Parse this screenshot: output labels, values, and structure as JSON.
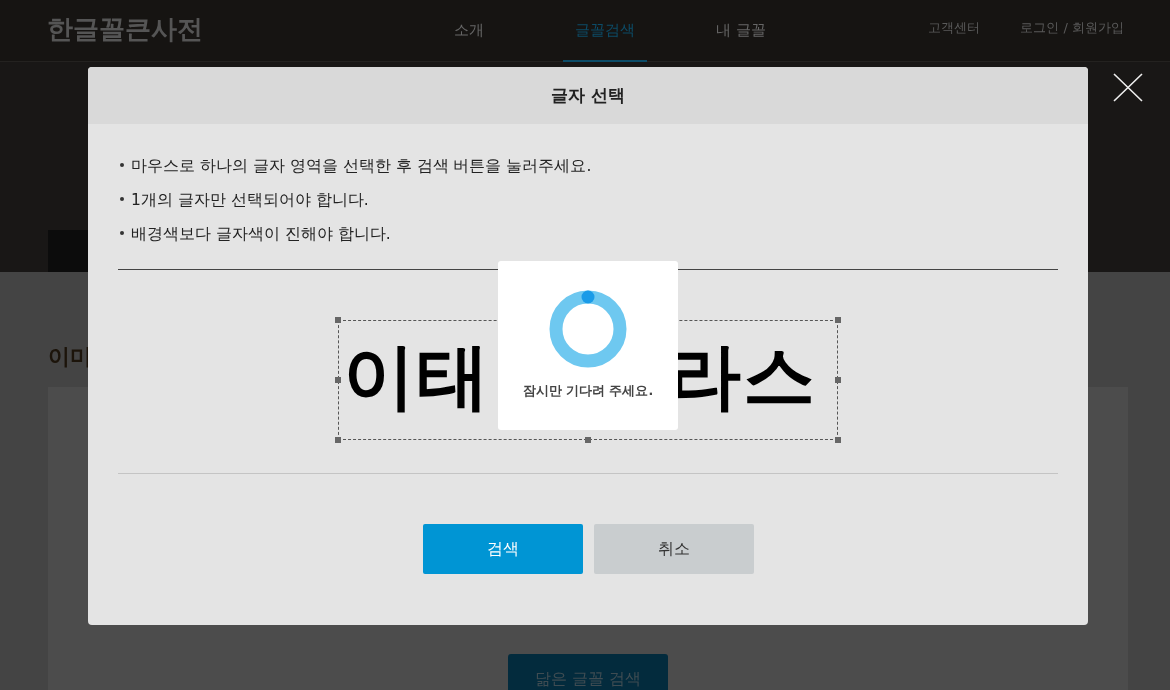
{
  "header": {
    "logo": "한글꼴큰사전",
    "nav": [
      {
        "label": "소개",
        "selected": false
      },
      {
        "label": "글꼴검색",
        "selected": true
      },
      {
        "label": "내 글꼴",
        "selected": false
      }
    ],
    "links": [
      "고객센터",
      "로그인 / 회원가입"
    ]
  },
  "page": {
    "heading": "이미",
    "search_button": "닮은 글꼴 검색"
  },
  "modal": {
    "title": "글자 선택",
    "instructions": [
      "마우스로 하나의 글자 영역을 선택한 후 검색 버튼을 눌러주세요.",
      "1개의 글자만 선택되어야 합니다.",
      "배경색보다 글자색이 진해야 합니다."
    ],
    "image_text": [
      "이태",
      "라스"
    ],
    "loader": {
      "message": "잠시만 기다려 주세요."
    },
    "buttons": [
      {
        "label": "검색",
        "kind": "primary"
      },
      {
        "label": "취소",
        "kind": "secondary"
      }
    ]
  }
}
